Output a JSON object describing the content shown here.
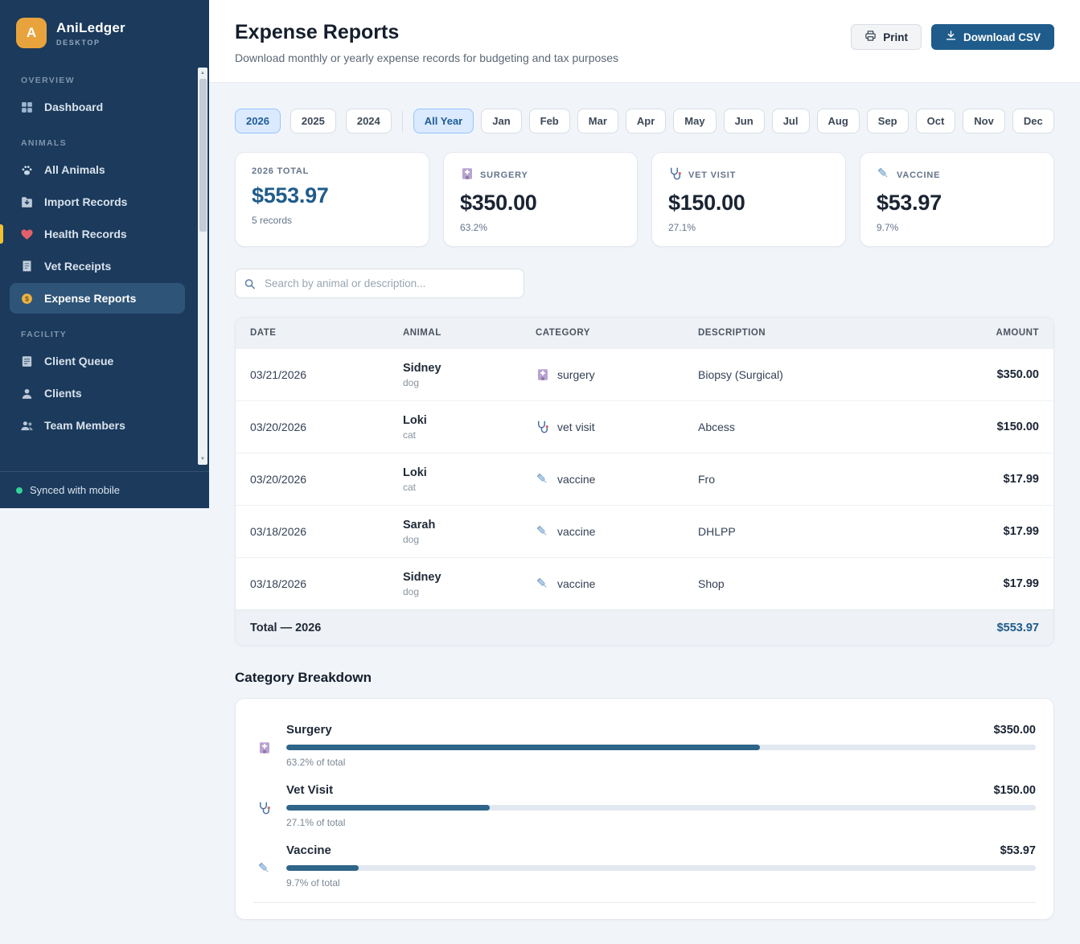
{
  "app": {
    "name": "AniLedger",
    "subtitle": "DESKTOP",
    "logo_letter": "A",
    "synced": "Synced with mobile"
  },
  "sidebar": {
    "sections": [
      {
        "label": "OVERVIEW",
        "items": [
          {
            "label": "Dashboard",
            "icon": "dashboard-icon",
            "active": false
          }
        ]
      },
      {
        "label": "ANIMALS",
        "items": [
          {
            "label": "All Animals",
            "icon": "paw-icon",
            "active": false
          },
          {
            "label": "Import Records",
            "icon": "import-icon",
            "active": false
          },
          {
            "label": "Health Records",
            "icon": "heart-icon",
            "active": false,
            "marker": true
          },
          {
            "label": "Vet Receipts",
            "icon": "receipt-icon",
            "active": false
          },
          {
            "label": "Expense Reports",
            "icon": "money-icon",
            "active": true
          }
        ]
      },
      {
        "label": "FACILITY",
        "items": [
          {
            "label": "Client Queue",
            "icon": "clipboard-icon",
            "active": false
          },
          {
            "label": "Clients",
            "icon": "person-icon",
            "active": false
          },
          {
            "label": "Team Members",
            "icon": "people-icon",
            "active": false
          }
        ]
      }
    ]
  },
  "header": {
    "title": "Expense Reports",
    "subtitle": "Download monthly or yearly expense records for budgeting and tax purposes",
    "print_label": "Print",
    "download_label": "Download CSV"
  },
  "filters": {
    "years": [
      "2026",
      "2025",
      "2024"
    ],
    "active_year": "2026",
    "months": [
      "All Year",
      "Jan",
      "Feb",
      "Mar",
      "Apr",
      "May",
      "Jun",
      "Jul",
      "Aug",
      "Sep",
      "Oct",
      "Nov",
      "Dec"
    ],
    "active_month": "All Year"
  },
  "summary_cards": [
    {
      "label": "2026 TOTAL",
      "value": "$553.97",
      "sub": "5 records",
      "accent": true
    },
    {
      "label": "SURGERY",
      "value": "$350.00",
      "sub": "63.2%",
      "icon": "surgery-icon"
    },
    {
      "label": "VET VISIT",
      "value": "$150.00",
      "sub": "27.1%",
      "icon": "vet-visit-icon"
    },
    {
      "label": "VACCINE",
      "value": "$53.97",
      "sub": "9.7%",
      "icon": "vaccine-icon"
    }
  ],
  "search": {
    "placeholder": "Search by animal or description..."
  },
  "table": {
    "columns": [
      "DATE",
      "ANIMAL",
      "CATEGORY",
      "DESCRIPTION",
      "AMOUNT"
    ],
    "rows": [
      {
        "date": "03/21/2026",
        "animal": "Sidney",
        "species": "dog",
        "category": "surgery",
        "description": "Biopsy (Surgical)",
        "amount": "$350.00"
      },
      {
        "date": "03/20/2026",
        "animal": "Loki",
        "species": "cat",
        "category": "vet visit",
        "description": "Abcess",
        "amount": "$150.00"
      },
      {
        "date": "03/20/2026",
        "animal": "Loki",
        "species": "cat",
        "category": "vaccine",
        "description": "Fro",
        "amount": "$17.99"
      },
      {
        "date": "03/18/2026",
        "animal": "Sarah",
        "species": "dog",
        "category": "vaccine",
        "description": "DHLPP",
        "amount": "$17.99"
      },
      {
        "date": "03/18/2026",
        "animal": "Sidney",
        "species": "dog",
        "category": "vaccine",
        "description": "Shop",
        "amount": "$17.99"
      }
    ],
    "footer": {
      "label": "Total — 2026",
      "amount": "$553.97"
    }
  },
  "breakdown": {
    "title": "Category Breakdown",
    "items": [
      {
        "name": "Surgery",
        "amount": "$350.00",
        "percent": 63.2,
        "percent_label": "63.2% of total"
      },
      {
        "name": "Vet Visit",
        "amount": "$150.00",
        "percent": 27.1,
        "percent_label": "27.1% of total"
      },
      {
        "name": "Vaccine",
        "amount": "$53.97",
        "percent": 9.7,
        "percent_label": "9.7% of total"
      }
    ]
  },
  "colors": {
    "accent": "#1f5c8b",
    "sidebar_bg": "#1b3a5c",
    "sidebar_active": "#2e5478",
    "logo_bg": "#e8a33d",
    "progress_fill": "#2e6589",
    "synced_dot": "#34d399",
    "pill_active_bg": "#dbeafe",
    "pill_active_border": "#93c5fd",
    "page_bg": "#f1f5f9"
  }
}
